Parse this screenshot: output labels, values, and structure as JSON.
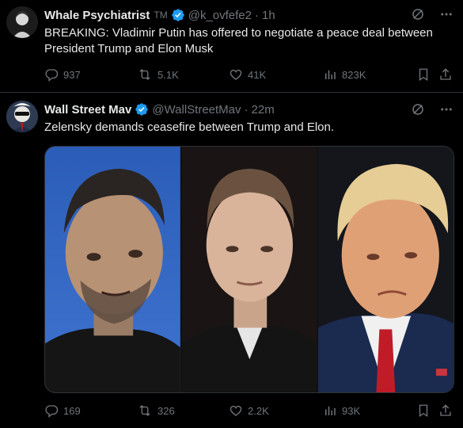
{
  "tweets": [
    {
      "name": "Whale Psychiatrist",
      "tm": "TM",
      "handle": "@k_ovfefe2",
      "dot": "·",
      "time": "1h",
      "text": "BREAKING: Vladimir Putin has offered to negotiate a peace deal between President Trump and Elon Musk",
      "replies": "937",
      "reposts": "5.1K",
      "likes": "41K",
      "views": "823K"
    },
    {
      "name": "Wall Street Mav",
      "handle": "@WallStreetMav",
      "dot": "·",
      "time": "22m",
      "text": "Zelensky demands ceasefire between Trump and Elon.",
      "replies": "169",
      "reposts": "326",
      "likes": "2.2K",
      "views": "93K",
      "media": [
        "photo-zelensky",
        "photo-musk",
        "photo-trump"
      ]
    }
  ],
  "colors": {
    "background": "#000000",
    "text": "#e7e9ea",
    "muted": "#71767b",
    "verified": "#1d9bf0",
    "border": "#2f3336"
  },
  "icons": [
    "verified-badge-icon",
    "grok-icon",
    "more-icon",
    "reply-icon",
    "repost-icon",
    "like-icon",
    "views-icon",
    "bookmark-icon",
    "share-icon"
  ]
}
